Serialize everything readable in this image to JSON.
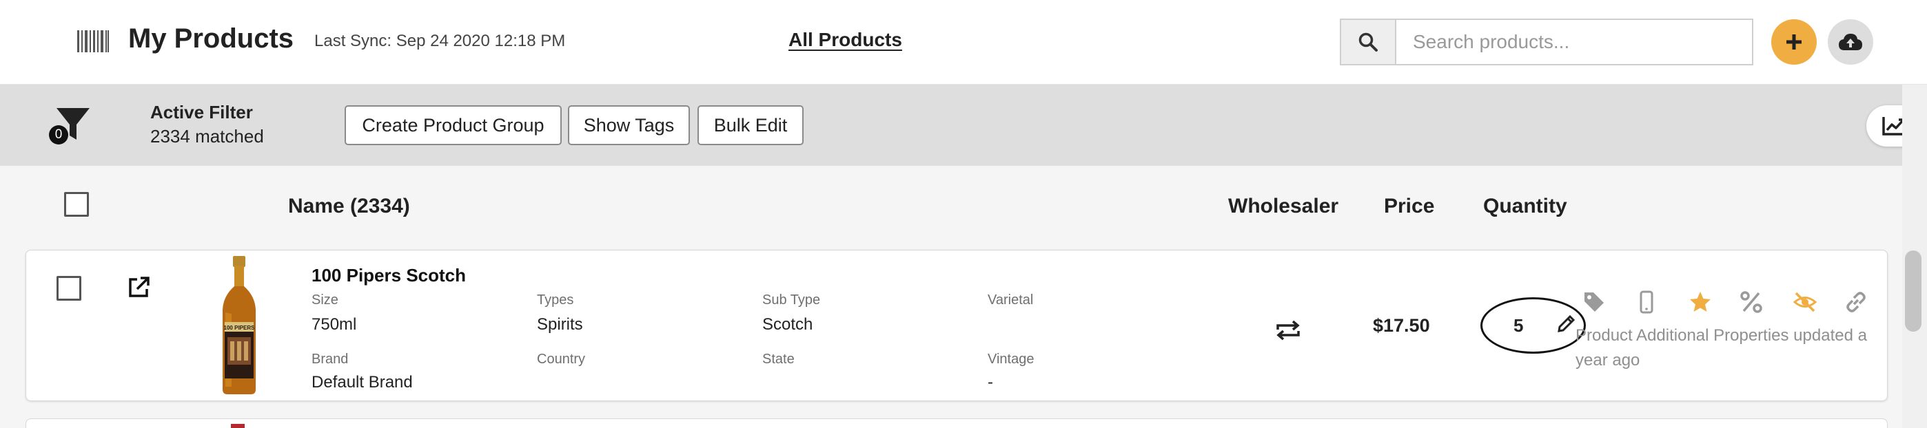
{
  "header": {
    "title": "My Products",
    "last_sync": "Last Sync: Sep 24 2020 12:18 PM",
    "all_products_link": "All Products",
    "search_placeholder": "Search products...",
    "search_icon": "search-icon",
    "add_icon": "plus-icon",
    "upload_icon": "cloud-upload-icon"
  },
  "filter_bar": {
    "filter_count": "0",
    "active_filter_label": "Active Filter",
    "matched_text": "2334 matched",
    "buttons": {
      "create_group": "Create Product Group",
      "show_tags": "Show Tags",
      "bulk_edit": "Bulk Edit"
    },
    "chart_icon": "line-chart-icon"
  },
  "table": {
    "columns": {
      "name": "Name  (2334)",
      "wholesaler": "Wholesaler",
      "price": "Price",
      "quantity": "Quantity"
    },
    "rows": [
      {
        "name": "100 Pipers Scotch",
        "fields": [
          {
            "label": "Size",
            "value": "750ml"
          },
          {
            "label": "Types",
            "value": "Spirits"
          },
          {
            "label": "Sub Type",
            "value": "Scotch"
          },
          {
            "label": "Varietal",
            "value": ""
          },
          {
            "label": "Brand",
            "value": "Default Brand"
          },
          {
            "label": "Country",
            "value": ""
          },
          {
            "label": "State",
            "value": ""
          },
          {
            "label": "Vintage",
            "value": "-"
          }
        ],
        "bottle_label": "100 PIPERS",
        "price": "$17.50",
        "quantity": "5",
        "updated_text": "Product Additional Properties updated a year ago",
        "action_icons": [
          "tag-icon",
          "mobile-icon",
          "star-icon",
          "percent-icon",
          "eye-slash-icon",
          "link-icon"
        ]
      }
    ]
  },
  "colors": {
    "accent": "#f0ad41",
    "filter_bar_bg": "#dedede",
    "muted_icon": "#9a9a9a"
  }
}
